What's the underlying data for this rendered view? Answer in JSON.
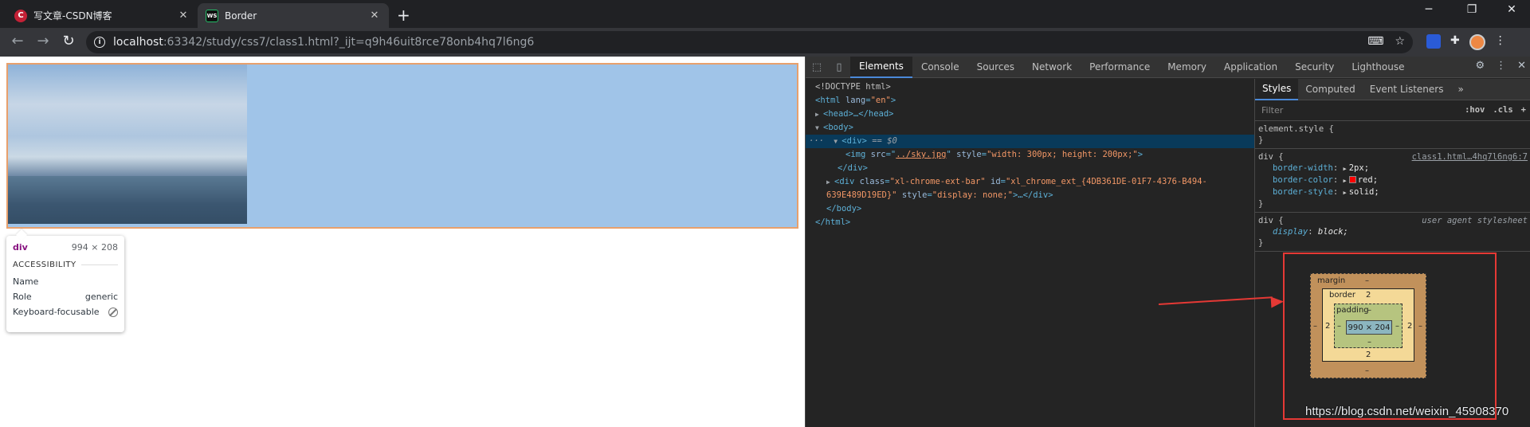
{
  "browser": {
    "tabs": [
      {
        "title": "写文章-CSDN博客",
        "icon": "csdn-icon",
        "active": false
      },
      {
        "title": "Border",
        "icon": "webstorm-icon",
        "active": true
      }
    ],
    "new_tab_symbol": "+",
    "close_symbol": "✕",
    "window_controls": [
      "─",
      "❐",
      "✕"
    ],
    "url_host": "localhost",
    "url_rest": ":63342/study/css7/class1.html?_ijt=q9h46uit8rce78onb4hq7l6ng6",
    "nav": {
      "back": "←",
      "forward": "→",
      "reload": "↻"
    },
    "omnibox_icons": [
      "translate-icon",
      "star-icon"
    ],
    "extension_icons": [
      "bookmark-extension-icon",
      "puzzle-icon",
      "avatar",
      "kebab-menu-icon"
    ]
  },
  "page": {
    "tooltip": {
      "tag": "div",
      "size": "994 × 208",
      "section": "ACCESSIBILITY",
      "rows": [
        {
          "label": "Name",
          "value": ""
        },
        {
          "label": "Role",
          "value": "generic"
        },
        {
          "label": "Keyboard-focusable",
          "value": ""
        }
      ]
    }
  },
  "devtools": {
    "tabs": [
      "Elements",
      "Console",
      "Sources",
      "Network",
      "Performance",
      "Memory",
      "Application",
      "Security",
      "Lighthouse"
    ],
    "active_tab": "Elements",
    "dom": {
      "doctype": "<!DOCTYPE html>",
      "html_open": "<html",
      "lang_attr": "lang",
      "lang_val": "\"en\"",
      "head": "<head>…</head>",
      "body_open": "<body>",
      "div_selected": "<div>",
      "eq0": "== $0",
      "img_open": "<img",
      "img_src_attr": "src",
      "img_src": "../sky.jpg",
      "img_style_attr": "style",
      "img_style": "\"width: 300px; height: 200px;\"",
      "div_close": "</div>",
      "div2_open": "<div",
      "div2_class_attr": "class",
      "div2_class": "\"xl-chrome-ext-bar\"",
      "div2_id_attr": "id",
      "div2_id_a": "\"xl_chrome_ext_{4DB361DE-01F7-4376-B494-",
      "div2_id_b": "639E489D19ED}\"",
      "div2_style_attr": "style",
      "div2_style": "\"display: none;\"",
      "div2_tail": ">…</div>",
      "body_close": "</body>",
      "html_close": "</html>",
      "dots": "···"
    },
    "styles": {
      "tabs": [
        "Styles",
        "Computed",
        "Event Listeners"
      ],
      "more": "»",
      "filter_placeholder": "Filter",
      "hov": ":hov",
      "cls": ".cls",
      "plus": "+",
      "element_style": "element.style {",
      "close_brace": "}",
      "rule1_selector": "div {",
      "rule1_source": "class1.html…4hq7l6ng6:7",
      "rule1_props": [
        {
          "name": "border-width",
          "value": "2px;"
        },
        {
          "name": "border-color",
          "value": "red;"
        },
        {
          "name": "border-style",
          "value": "solid;"
        }
      ],
      "rule2_selector": "div {",
      "rule2_source": "user agent stylesheet",
      "rule2_prop_name": "display",
      "rule2_prop_value": "block;"
    },
    "box_model": {
      "margin_label": "margin",
      "margin_top": "–",
      "margin_bottom": "–",
      "margin_left": "–",
      "margin_right": "–",
      "border_label": "border",
      "border_top": "2",
      "border_bottom": "2",
      "border_left": "2",
      "border_right": "2",
      "padding_label": "padding",
      "padding_top": "–",
      "padding_bottom": "–",
      "padding_left": "–",
      "padding_right": "–",
      "content": "990 × 204"
    }
  },
  "watermark": "https://blog.csdn.net/weixin_45908370",
  "colors": {
    "div_border": "#e8a06c",
    "div_bg": "#a0c4e8",
    "annotation": "#e53935"
  }
}
